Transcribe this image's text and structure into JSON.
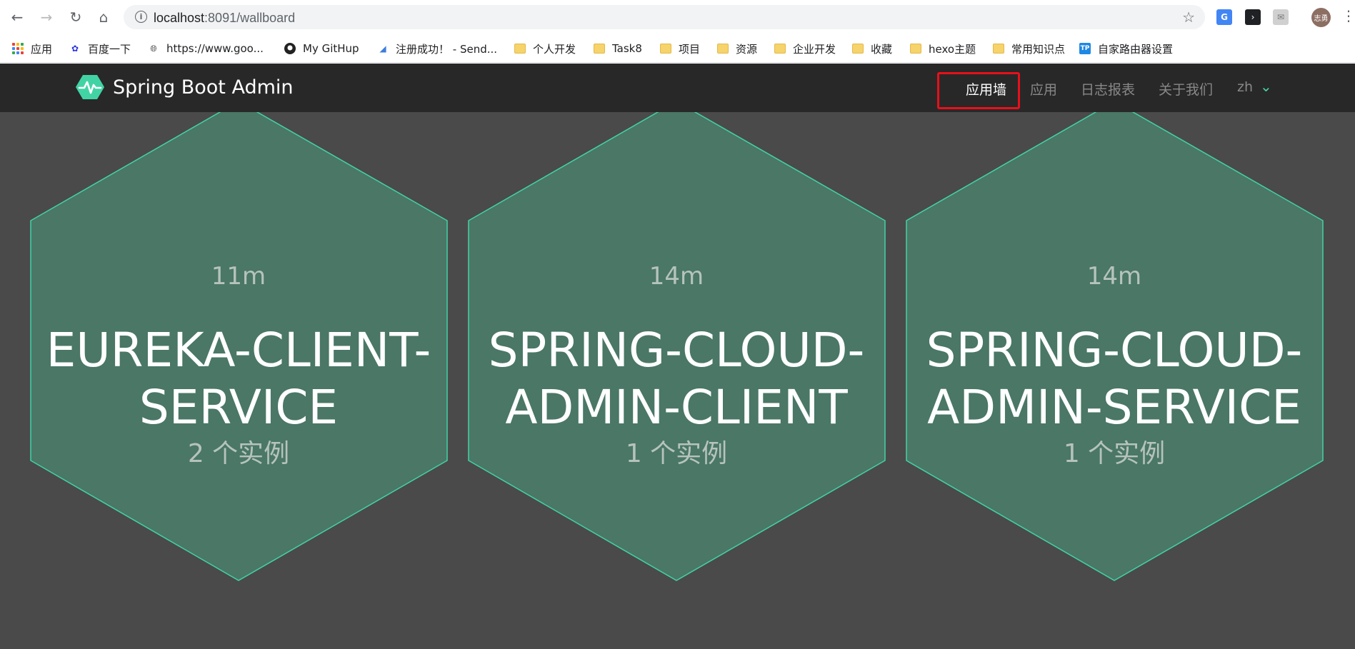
{
  "browser": {
    "url_host": "localhost",
    "url_rest": ":8091/wallboard",
    "avatar_text": "志勇",
    "bookmarks": [
      {
        "label": "应用",
        "icon": "apps-icon"
      },
      {
        "label": "百度一下",
        "icon": "baidu-paw-icon"
      },
      {
        "label": "https://www.goo...",
        "icon": "globe-icon"
      },
      {
        "label": "My GitHup",
        "icon": "github-icon"
      },
      {
        "label": "注册成功！ - Send...",
        "icon": "sendcloud-icon"
      },
      {
        "label": "个人开发",
        "icon": "folder-icon"
      },
      {
        "label": "Task8",
        "icon": "folder-icon"
      },
      {
        "label": "项目",
        "icon": "folder-icon"
      },
      {
        "label": "资源",
        "icon": "folder-icon"
      },
      {
        "label": "企业开发",
        "icon": "folder-icon"
      },
      {
        "label": "收藏",
        "icon": "folder-icon"
      },
      {
        "label": "hexo主题",
        "icon": "folder-icon"
      },
      {
        "label": "常用知识点",
        "icon": "folder-icon"
      },
      {
        "label": "自家路由器设置",
        "icon": "tp-link-icon"
      }
    ]
  },
  "app": {
    "title": "Spring Boot Admin",
    "nav": {
      "wallboard": "应用墙",
      "applications": "应用",
      "journal": "日志报表",
      "about": "关于我们",
      "lang": "zh"
    },
    "colors": {
      "accent": "#42d3a5",
      "hex_fill": "#4a7766",
      "background": "#4a4a4a",
      "navbar": "#282828",
      "highlight": "#e8101a"
    },
    "applications": [
      {
        "uptime": "11m",
        "name_line1": "EUREKA-CLIENT-",
        "name_line2": "SERVICE",
        "instances": "2 个实例"
      },
      {
        "uptime": "14m",
        "name_line1": "SPRING-CLOUD-",
        "name_line2": "ADMIN-CLIENT",
        "instances": "1 个实例"
      },
      {
        "uptime": "14m",
        "name_line1": "SPRING-CLOUD-",
        "name_line2": "ADMIN-SERVICE",
        "instances": "1 个实例"
      }
    ]
  }
}
